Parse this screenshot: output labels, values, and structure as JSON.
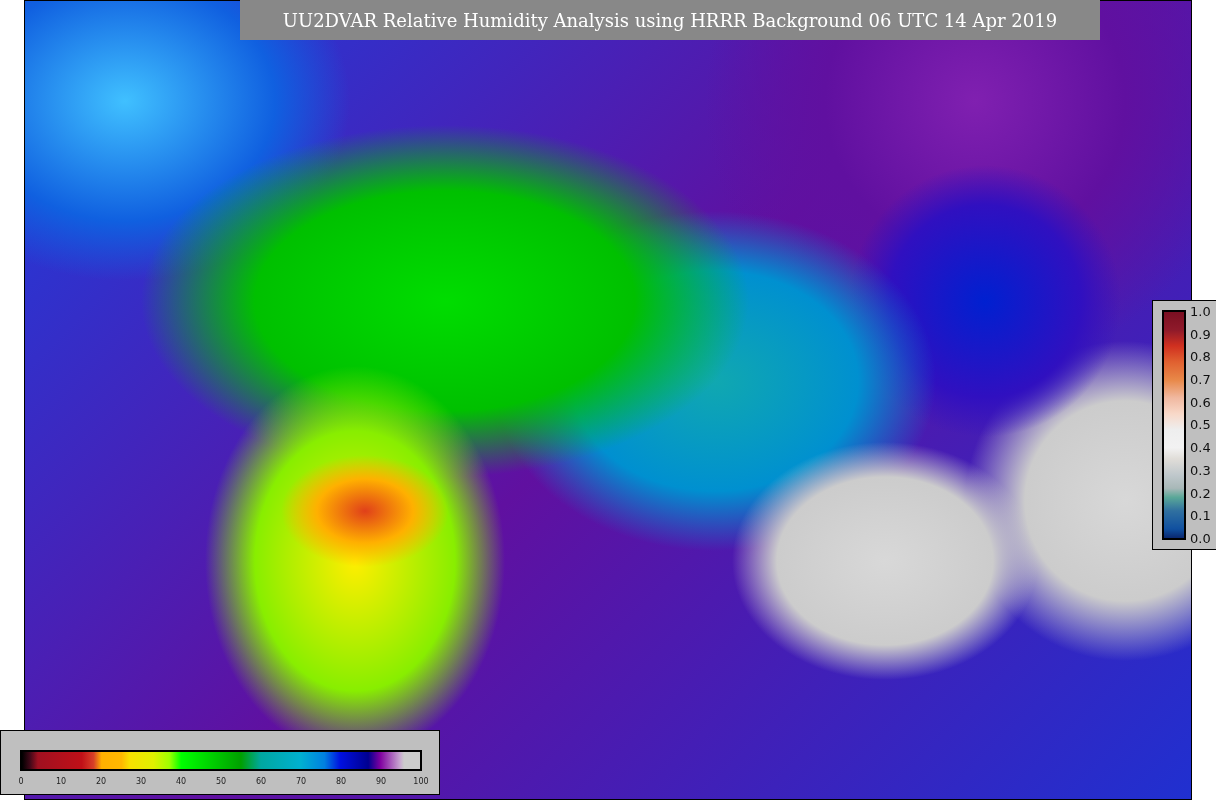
{
  "title": "UU2DVAR Relative Humidity Analysis using HRRR Background 06 UTC 14 Apr 2019",
  "station_colorbar": {
    "ticks": [
      "1.0",
      "0.9",
      "0.8",
      "0.7",
      "0.6",
      "0.5",
      "0.4",
      "0.3",
      "0.2",
      "0.1",
      "0.0"
    ]
  },
  "humidity_colorbar": {
    "ticks": [
      "0",
      "10",
      "20",
      "30",
      "40",
      "50",
      "60",
      "70",
      "80",
      "90",
      "100"
    ]
  }
}
